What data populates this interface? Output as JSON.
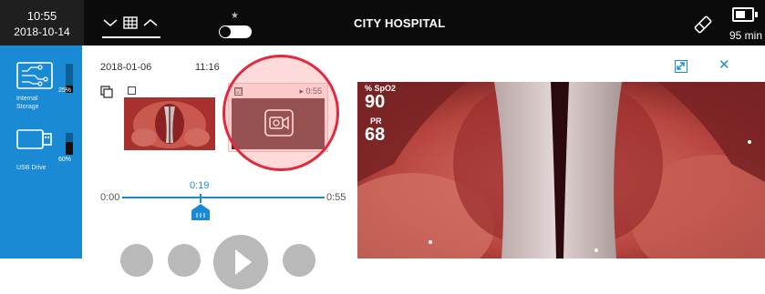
{
  "topbar": {
    "time": "10:55",
    "date": "2018-10-14",
    "hospital_name": "CITY HOSPITAL",
    "battery_remaining": "95 min",
    "icons": [
      "chevron-down-icon",
      "grid-icon",
      "chevron-up-icon",
      "star-icon",
      "toggle",
      "eraser-icon",
      "battery-icon"
    ]
  },
  "sidebar": {
    "storages": [
      {
        "label": "Internal Storage",
        "usage_pct_text": "25%",
        "usage_fraction": 0.25,
        "icon": "internal-storage-icon"
      },
      {
        "label": "USB Drive",
        "usage_pct_text": "60%",
        "usage_fraction": 0.6,
        "icon": "usb-drive-icon"
      }
    ]
  },
  "session": {
    "date": "2018-01-06",
    "time": "11:16"
  },
  "media": {
    "video_duration": "0:55",
    "video_selected_mark": "☑"
  },
  "timeline": {
    "start": "0:00",
    "current": "0:19",
    "end": "0:55"
  },
  "vitals": {
    "spo2_label": "% SpO2",
    "spo2_value": "90",
    "pr_label": "PR",
    "pr_value": "68"
  },
  "colors": {
    "accent": "#1a8ad4",
    "highlight_ring": "#e3293c",
    "topbar": "#0b0b0b"
  }
}
